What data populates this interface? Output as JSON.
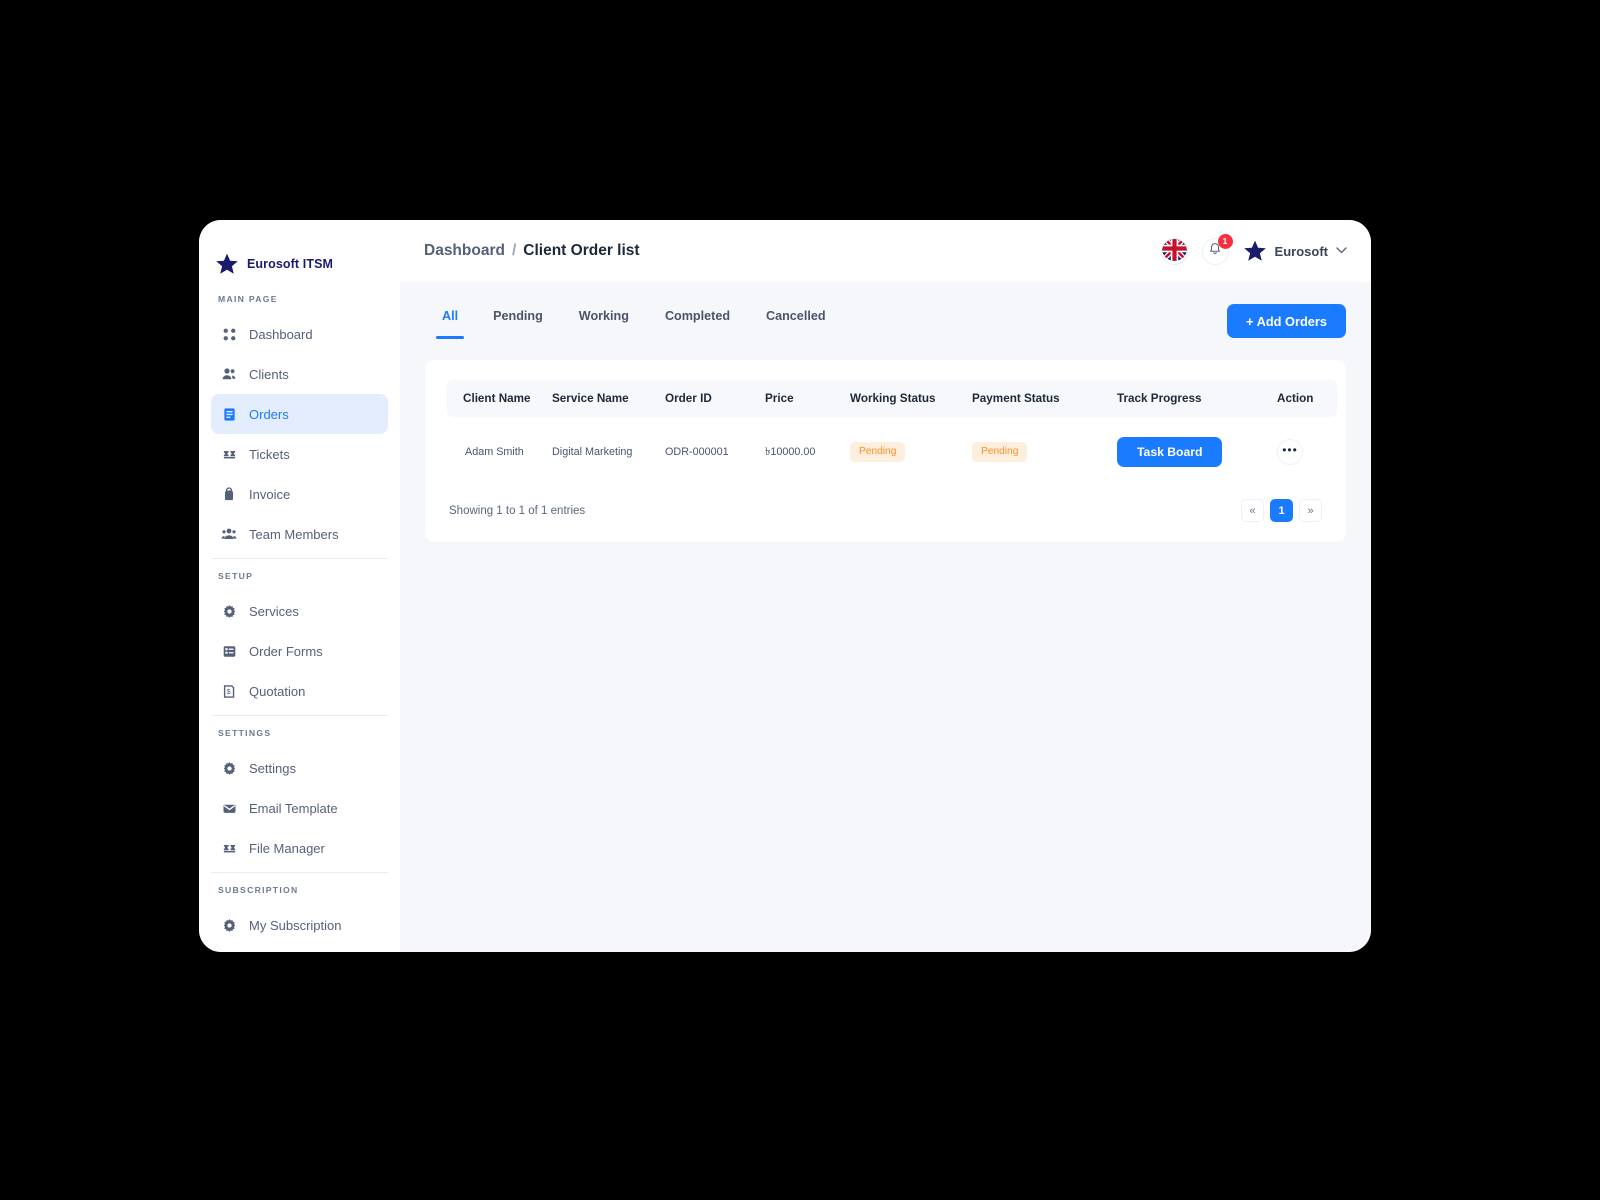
{
  "sidebar": {
    "brand": {
      "name": "Eurosoft ITSM",
      "logo_icon": "star-icon"
    },
    "groups": [
      {
        "heading": "MAIN PAGE",
        "items": [
          {
            "label": "Dashboard",
            "icon": "grid-dots-icon",
            "active": false
          },
          {
            "label": "Clients",
            "icon": "users-icon",
            "active": false
          },
          {
            "label": "Orders",
            "icon": "list-box-icon",
            "active": true
          },
          {
            "label": "Tickets",
            "icon": "ticket-icon",
            "active": false
          },
          {
            "label": "Invoice",
            "icon": "lock-doc-icon",
            "active": false
          },
          {
            "label": "Team Members",
            "icon": "team-icon",
            "active": false
          }
        ]
      },
      {
        "heading": "SETUP",
        "items": [
          {
            "label": "Services",
            "icon": "gear-icon",
            "active": false
          },
          {
            "label": "Order Forms",
            "icon": "form-list-icon",
            "active": false
          },
          {
            "label": "Quotation",
            "icon": "receipt-icon",
            "active": false
          }
        ]
      },
      {
        "heading": "SETTINGS",
        "items": [
          {
            "label": "Settings",
            "icon": "gear-icon",
            "active": false
          },
          {
            "label": "Email Template",
            "icon": "mail-icon",
            "active": false
          },
          {
            "label": "File Manager",
            "icon": "puzzle-icon",
            "active": false
          }
        ]
      },
      {
        "heading": "SUBSCRIPTION",
        "items": [
          {
            "label": "My Subscription",
            "icon": "gear-icon",
            "active": false
          }
        ]
      }
    ]
  },
  "topbar": {
    "breadcrumb": {
      "parent": "Dashboard",
      "separator": "/",
      "current": "Client Order list"
    },
    "language_icon": "uk-flag-icon",
    "notifications": {
      "icon": "bell-icon",
      "count": "1"
    },
    "user": {
      "avatar_icon": "star-icon",
      "name": "Eurosoft",
      "caret_icon": "chevron-down-icon"
    }
  },
  "content": {
    "tabs": [
      {
        "label": "All",
        "active": true
      },
      {
        "label": "Pending",
        "active": false
      },
      {
        "label": "Working",
        "active": false
      },
      {
        "label": "Completed",
        "active": false
      },
      {
        "label": "Cancelled",
        "active": false
      }
    ],
    "add_button": "+ Add Orders",
    "table": {
      "columns": [
        "Client Name",
        "Service Name",
        "Order ID",
        "Price",
        "Working Status",
        "Payment Status",
        "Track Progress",
        "Action"
      ],
      "rows": [
        {
          "client_name": "Adam Smith",
          "service_name": "Digital Marketing",
          "order_id": "ODR-000001",
          "price": "৳10000.00",
          "working_status": "Pending",
          "payment_status": "Pending",
          "track_progress": "Task Board",
          "action_icon": "kebab-menu-icon",
          "action_glyph": "•••"
        }
      ]
    },
    "footer": {
      "showing": "Showing 1 to 1 of 1 entries",
      "pager": {
        "prev": "«",
        "current": "1",
        "next": "»"
      }
    }
  },
  "colors": {
    "accent": "#1b7bff",
    "badge_text": "#f79129",
    "badge_bg": "#fdeedd",
    "brand": "#1b1b6e",
    "notif": "#f5313f"
  }
}
